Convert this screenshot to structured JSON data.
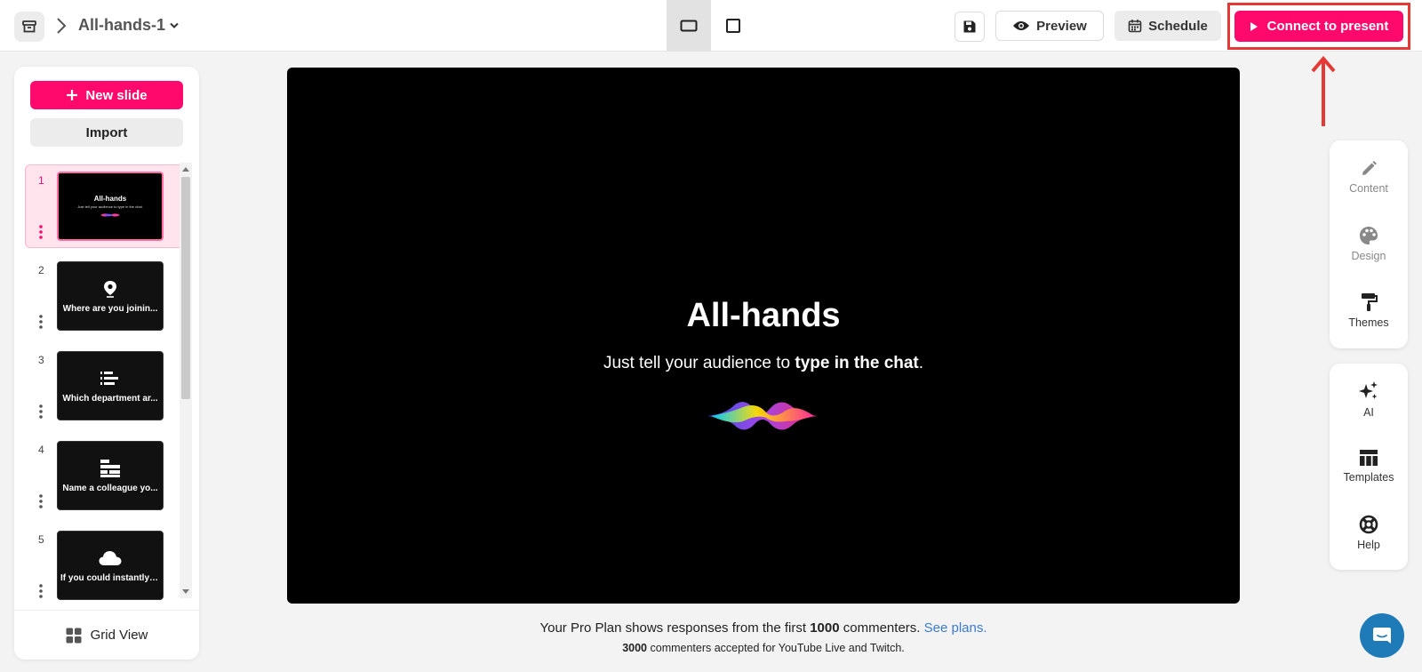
{
  "header": {
    "deck_title": "All-hands-1",
    "preview_label": "Preview",
    "schedule_label": "Schedule",
    "connect_label": "Connect to present"
  },
  "sidebar": {
    "new_slide_label": "New slide",
    "import_label": "Import",
    "grid_view_label": "Grid View",
    "slides": [
      {
        "number": "1",
        "title": "All-hands",
        "subtitle": "Just tell your audience to type in the chat."
      },
      {
        "number": "2",
        "text": "Where are you joinin...",
        "icon": "map-pin-icon"
      },
      {
        "number": "3",
        "text": "Which department ar...",
        "icon": "ranked-list-icon"
      },
      {
        "number": "4",
        "text": "Name a colleague yo...",
        "icon": "word-blocks-icon"
      },
      {
        "number": "5",
        "text": "If you could instantly i...",
        "icon": "cloud-icon"
      }
    ]
  },
  "slide": {
    "title": "All-hands",
    "subtitle_prefix": "Just tell your audience to ",
    "subtitle_bold": "type in the chat",
    "subtitle_suffix": "."
  },
  "notice": {
    "line1_prefix": "Your Pro Plan shows responses from the first ",
    "line1_bold": "1000",
    "line1_suffix": " commenters. ",
    "see_plans_label": "See plans.",
    "line2_bold": "3000",
    "line2_suffix": " commenters accepted for YouTube Live and Twitch."
  },
  "tools": {
    "content_label": "Content",
    "design_label": "Design",
    "themes_label": "Themes",
    "ai_label": "AI",
    "templates_label": "Templates",
    "help_label": "Help"
  },
  "colors": {
    "accent": "#ff0a6c",
    "annotation": "#e53935",
    "link": "#3a7bd5",
    "chat": "#1f7ab8"
  }
}
